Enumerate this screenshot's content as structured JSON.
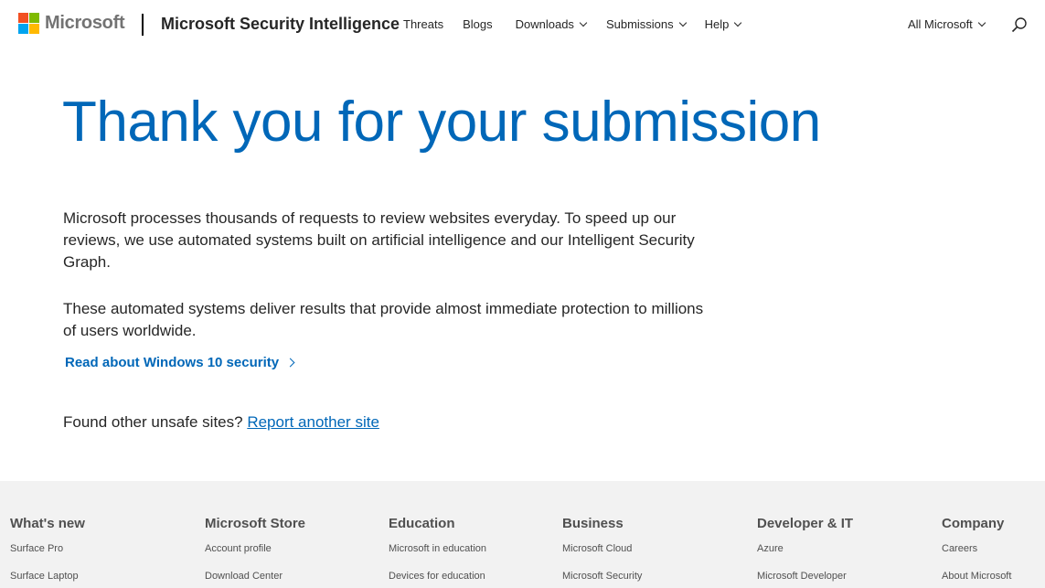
{
  "header": {
    "brand": "Microsoft",
    "site_title": "Microsoft Security Intelligence",
    "nav": {
      "threats": "Threats",
      "blogs": "Blogs",
      "downloads": "Downloads",
      "submissions": "Submissions",
      "help": "Help"
    },
    "all_microsoft": "All Microsoft",
    "search_icon": "search-icon",
    "logo_colors": [
      "#f25022",
      "#7fba00",
      "#00a4ef",
      "#ffb900"
    ]
  },
  "main": {
    "title": "Thank you for your submission",
    "paragraph1": "Microsoft processes thousands of requests to review websites everyday. To speed up our reviews, we use automated systems built on artificial intelligence and our Intelligent Security Graph.",
    "paragraph2": "These automated systems deliver results that provide almost immediate protection to millions of users worldwide.",
    "read_link": "Read about Windows 10 security",
    "found_text": "Found other unsafe sites?",
    "report_link": "Report another site"
  },
  "footer": {
    "columns": [
      {
        "heading": "What's new",
        "links": [
          "Surface Pro",
          "Surface Laptop"
        ]
      },
      {
        "heading": "Microsoft Store",
        "links": [
          "Account profile",
          "Download Center"
        ]
      },
      {
        "heading": "Education",
        "links": [
          "Microsoft in education",
          "Devices for education"
        ]
      },
      {
        "heading": "Business",
        "links": [
          "Microsoft Cloud",
          "Microsoft Security"
        ]
      },
      {
        "heading": "Developer & IT",
        "links": [
          "Azure",
          "Microsoft Developer"
        ]
      },
      {
        "heading": "Company",
        "links": [
          "Careers",
          "About Microsoft"
        ]
      }
    ]
  },
  "colors": {
    "accent": "#0067b8",
    "footer_bg": "#f2f2f2",
    "text": "#262626"
  }
}
